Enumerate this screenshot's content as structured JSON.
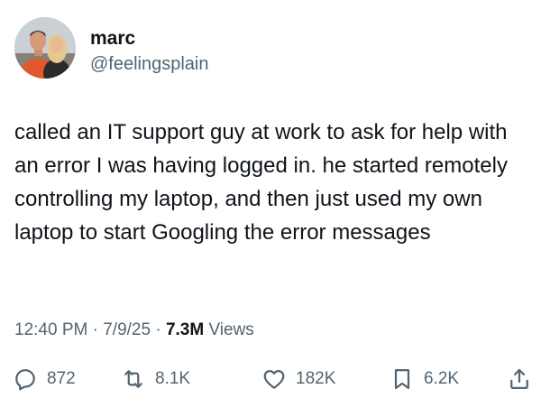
{
  "author": {
    "name": "marc",
    "handle": "@feelingsplain"
  },
  "tweet": {
    "text": "called an IT support guy at work to ask for help with an error I was having logged in. he started remotely controlling my laptop, and then just used my own laptop to start Googling the error messages"
  },
  "meta": {
    "time": "12:40 PM",
    "sep1": " · ",
    "date": "7/9/25",
    "sep2": " · ",
    "views_count": "7.3M",
    "views_label": " Views"
  },
  "actions": {
    "replies": "872",
    "reposts": "8.1K",
    "likes": "182K",
    "bookmarks": "6.2K"
  },
  "icons": {
    "reply": "reply-icon",
    "repost": "repost-icon",
    "like": "heart-icon",
    "bookmark": "bookmark-icon",
    "share": "share-icon"
  },
  "colors": {
    "text": "#0f1419",
    "secondary": "#536471"
  }
}
